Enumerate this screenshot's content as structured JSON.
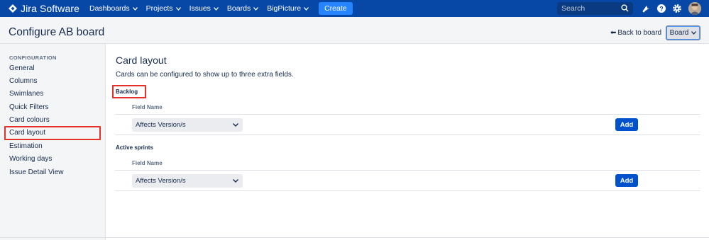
{
  "app": {
    "logo_text": "Jira Software",
    "nav": [
      {
        "label": "Dashboards",
        "has_menu": true
      },
      {
        "label": "Projects",
        "has_menu": true
      },
      {
        "label": "Issues",
        "has_menu": true
      },
      {
        "label": "Boards",
        "has_menu": true
      },
      {
        "label": "BigPicture",
        "has_menu": true
      }
    ],
    "create_label": "Create",
    "search_placeholder": "Search",
    "icons": [
      "search-icon",
      "notifications-icon",
      "help-icon",
      "settings-icon",
      "avatar"
    ],
    "colors": {
      "nav_bg": "#0747a6",
      "create_bg": "#2684ff",
      "primary": "#0052cc",
      "highlight": "#e5302a"
    }
  },
  "header": {
    "title": "Configure AB board",
    "back_link": "Back to board",
    "board_button": "Board"
  },
  "sidebar": {
    "heading": "CONFIGURATION",
    "items": [
      {
        "label": "General"
      },
      {
        "label": "Columns"
      },
      {
        "label": "Swimlanes"
      },
      {
        "label": "Quick Filters"
      },
      {
        "label": "Card colours"
      },
      {
        "label": "Card layout",
        "active": true
      },
      {
        "label": "Estimation"
      },
      {
        "label": "Working days"
      },
      {
        "label": "Issue Detail View"
      }
    ]
  },
  "main": {
    "title": "Card layout",
    "description": "Cards can be configured to show up to three extra fields.",
    "sections": [
      {
        "title": "Backlog",
        "field_header": "Field Name",
        "select_value": "Affects Version/s",
        "add_label": "Add"
      },
      {
        "title": "Active sprints",
        "field_header": "Field Name",
        "select_value": "Affects Version/s",
        "add_label": "Add"
      }
    ]
  }
}
